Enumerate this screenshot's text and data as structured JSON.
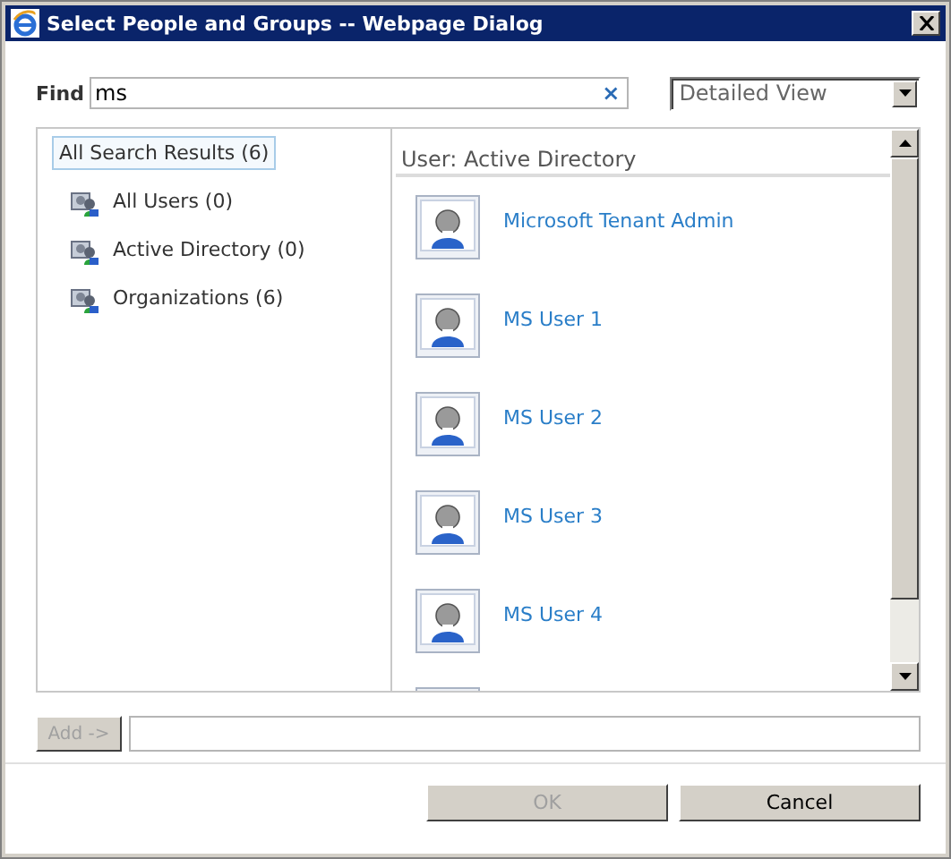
{
  "window": {
    "title": "Select People and Groups -- Webpage Dialog"
  },
  "find": {
    "label": "Find",
    "value": "ms",
    "clear": "×"
  },
  "view": {
    "value": "Detailed View"
  },
  "tree": {
    "items": [
      {
        "label": "All Search Results (6)",
        "selected": true,
        "children": [
          {
            "label": "All Users (0)",
            "selected": false
          },
          {
            "label": "Active Directory (0)",
            "selected": false
          },
          {
            "label": "Organizations (6)",
            "selected": false
          }
        ]
      }
    ]
  },
  "results": {
    "header": "User:  Active Directory",
    "items": [
      {
        "kind": "user",
        "name": "Microsoft Tenant Admin"
      },
      {
        "kind": "user",
        "name": "MS User 1"
      },
      {
        "kind": "user",
        "name": "MS User 2"
      },
      {
        "kind": "user",
        "name": "MS User 3"
      },
      {
        "kind": "user",
        "name": "MS User 4"
      },
      {
        "kind": "cut"
      }
    ]
  },
  "add": {
    "label": "Add ->",
    "disabled": true
  },
  "buttons": [
    {
      "label": "OK",
      "disabled": true
    },
    {
      "label": "Cancel",
      "disabled": false
    }
  ]
}
